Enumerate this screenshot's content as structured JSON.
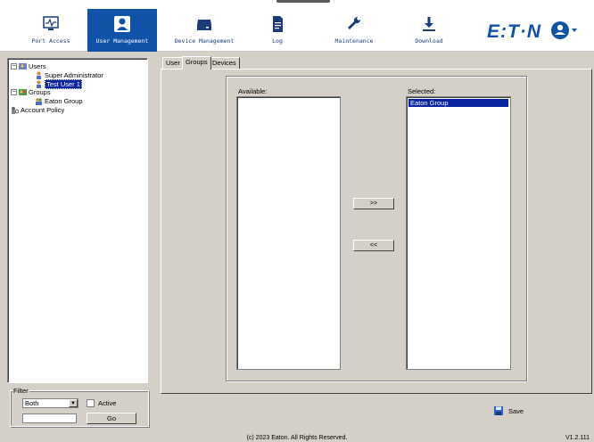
{
  "nav": {
    "items": [
      {
        "label": "Port Access",
        "icon": "monitor-icon"
      },
      {
        "label": "User Management",
        "icon": "user-icon",
        "active": true
      },
      {
        "label": "Device Management",
        "icon": "drive-icon"
      },
      {
        "label": "Log",
        "icon": "document-icon"
      },
      {
        "label": "Maintenance",
        "icon": "wrench-icon"
      },
      {
        "label": "Download",
        "icon": "download-icon"
      }
    ],
    "brand": "E:T·N",
    "accent": "#0f52a8"
  },
  "tree": {
    "users_label": "Users",
    "users": [
      "Super Administrator",
      "Test User 1"
    ],
    "selected_user": "Test User 1",
    "groups_label": "Groups",
    "groups": [
      "Eaton Group"
    ],
    "account_policy": "Account Policy"
  },
  "filter": {
    "legend": "Filter",
    "selected": "Both",
    "active_label": "Active",
    "active_checked": false,
    "input_value": "",
    "go_label": "Go"
  },
  "tabs": [
    {
      "label": "User"
    },
    {
      "label": "Groups",
      "active": true
    },
    {
      "label": "Devices"
    }
  ],
  "groups_panel": {
    "available_label": "Available:",
    "available_items": [],
    "selected_label": "Selected:",
    "selected_items": [
      "Eaton Group"
    ],
    "add_label": ">>",
    "remove_label": "<<"
  },
  "save_label": "Save",
  "footer": {
    "copyright": "(c) 2023 Eaton. All Rights Reserved.",
    "version": "V1.2.111"
  }
}
